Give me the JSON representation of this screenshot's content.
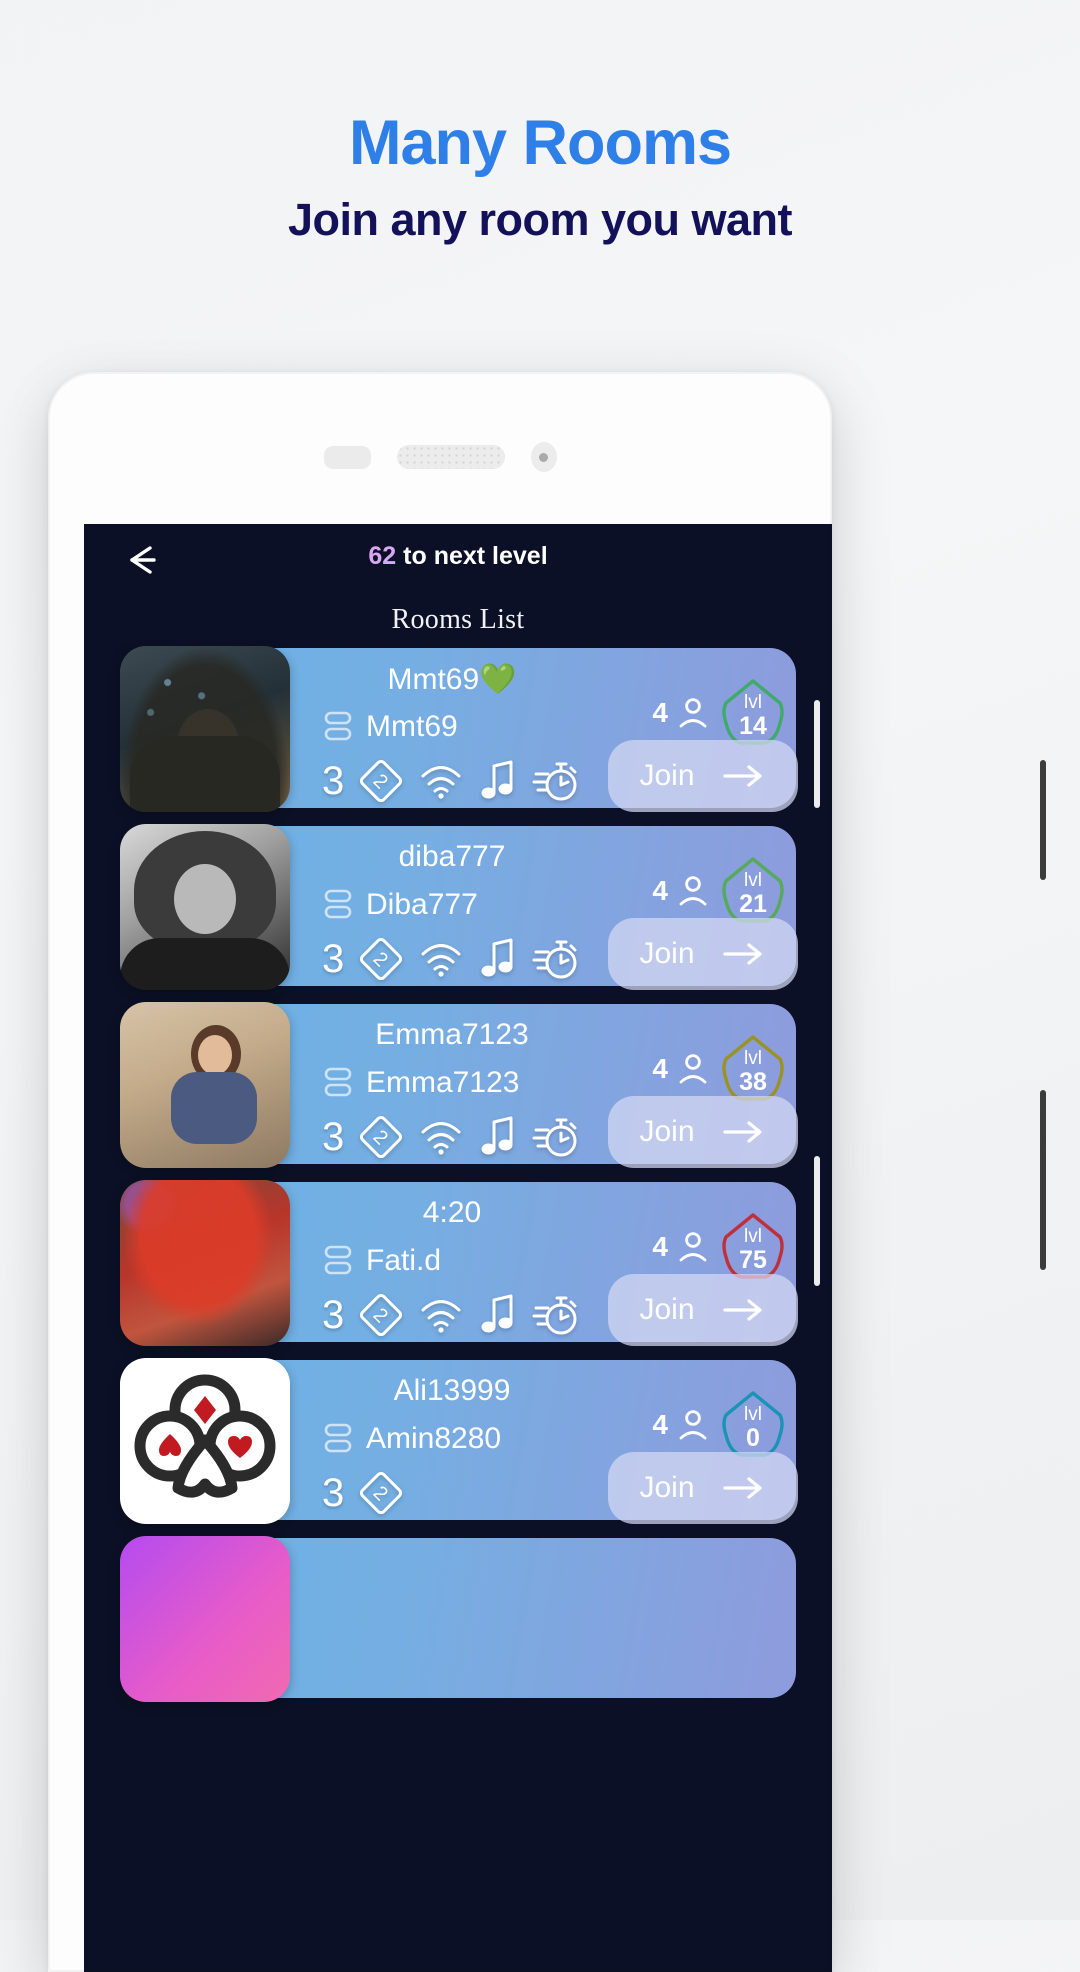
{
  "promo": {
    "title": "Many Rooms",
    "subtitle": "Join any room you want",
    "title_color": "#2f7fe8",
    "subtitle_color": "#13115a"
  },
  "app": {
    "level_progress_number": "62",
    "level_progress_label": "to next level",
    "level_number_color": "#d9a8f5",
    "section_title": "Rooms List",
    "back_icon": "back-arrow-icon"
  },
  "rooms": [
    {
      "room_name": "Mmt69💚",
      "owner": "Mmt69",
      "feature_number": "3",
      "features": [
        "diamond-2-icon",
        "wifi-icon",
        "music-note-icon",
        "stopwatch-icon"
      ],
      "people_count": "4",
      "level_label": "lvl",
      "level_value": "14",
      "level_color": "#3faa6a",
      "join_label": "Join",
      "avatar": "art-1"
    },
    {
      "room_name": "diba777",
      "owner": "Diba777",
      "feature_number": "3",
      "features": [
        "diamond-2-icon",
        "wifi-icon",
        "music-note-icon",
        "stopwatch-icon"
      ],
      "people_count": "4",
      "level_label": "lvl",
      "level_value": "21",
      "level_color": "#57a95c",
      "join_label": "Join",
      "avatar": "art-2"
    },
    {
      "room_name": "Emma7123",
      "owner": "Emma7123",
      "feature_number": "3",
      "features": [
        "diamond-2-icon",
        "wifi-icon",
        "music-note-icon",
        "stopwatch-icon"
      ],
      "people_count": "4",
      "level_label": "lvl",
      "level_value": "38",
      "level_color": "#9a9323",
      "join_label": "Join",
      "avatar": "art-3"
    },
    {
      "room_name": "4:20",
      "owner": "Fati.d",
      "feature_number": "3",
      "features": [
        "diamond-2-icon",
        "wifi-icon",
        "music-note-icon",
        "stopwatch-icon"
      ],
      "people_count": "4",
      "level_label": "lvl",
      "level_value": "75",
      "level_color": "#c0303a",
      "join_label": "Join",
      "avatar": "art-4"
    },
    {
      "room_name": "Ali13999",
      "owner": "Amin8280",
      "feature_number": "3",
      "features": [
        "diamond-2-icon"
      ],
      "people_count": "4",
      "level_label": "lvl",
      "level_value": "0",
      "level_color": "#1b93b5",
      "join_label": "Join",
      "avatar": "art-5"
    }
  ]
}
